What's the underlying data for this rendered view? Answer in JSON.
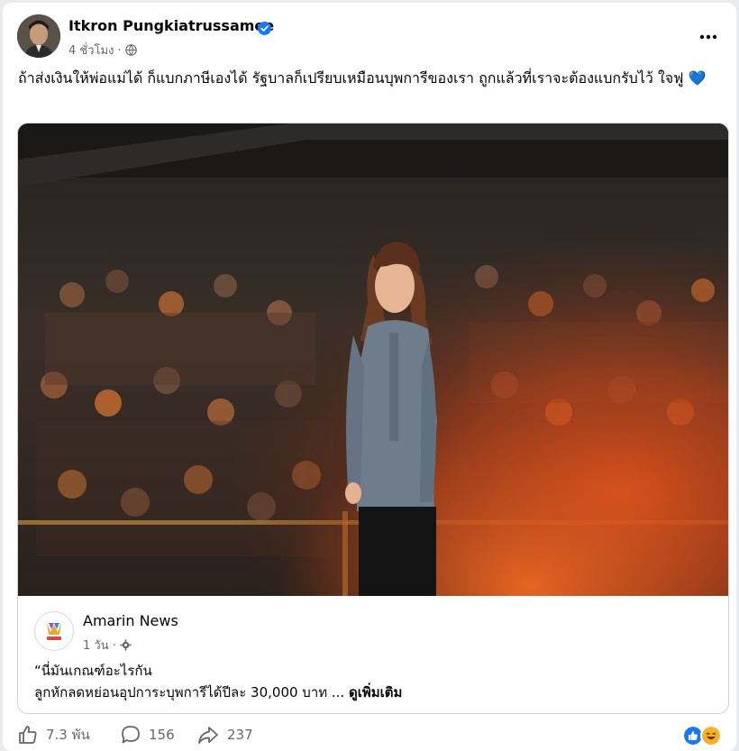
{
  "post": {
    "author": "Itkron Pungkiatrussamee",
    "time": "4 ชั่วโมง ·",
    "caption": "ถ้าส่งเงินให้พ่อแม่ได้ ก็แบกภาษีเองได้ รัฐบาลก็เปรียบเหมือนบุพการีของเรา ถูกแล้วที่เราจะต้องแบกรับไว้ ใจฟู 💙",
    "more_icon": "ellipsis-icon",
    "privacy_icon": "globe-icon"
  },
  "shared": {
    "source_name": "Amarin News",
    "time": "1 วัน ·",
    "privacy_icon": "gear-icon",
    "line1": "“นี่มันเกณฑ์อะไรกัน",
    "line2": "ลูกหักลดหย่อนอุปการะบุพการีได้ปีละ 30,000 บาท ...",
    "see_more": "ดูเพิ่มเติม"
  },
  "stats": {
    "likes": "7.3 พัน",
    "comments": "156",
    "shares": "237",
    "reaction_icons": [
      "like-icon",
      "haha-icon"
    ]
  },
  "colors": {
    "verified": "#1877f2",
    "like_reaction": "#1877f2",
    "haha_reaction": "#f7b125",
    "muted_text": "#65676b"
  }
}
